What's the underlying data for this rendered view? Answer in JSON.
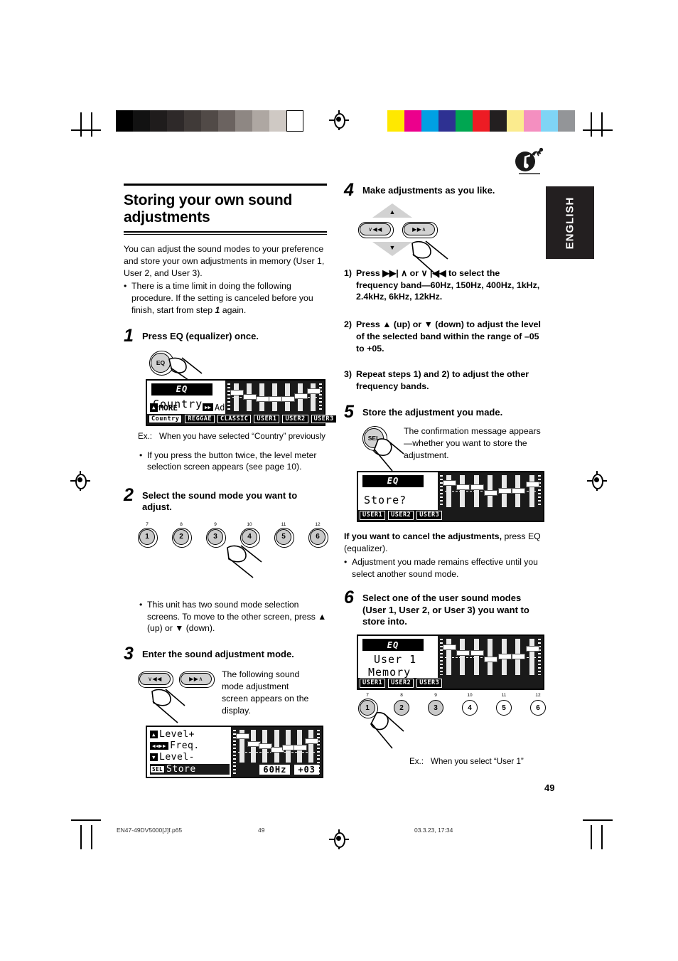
{
  "document": {
    "language_tab": "ENGLISH",
    "page_number": "49",
    "footer": {
      "filename": "EN47-49DV5000[J]f.p65",
      "page": "49",
      "timestamp": "03.3.23, 17:34"
    }
  },
  "heading": {
    "title_line1": "Storing your own sound",
    "title_line2": "adjustments"
  },
  "intro": {
    "paragraph": "You can adjust the sound modes to your preference and store your own adjustments in memory (User 1, User 2, and User 3).",
    "bullet_pre": "There is a time limit in doing the following procedure. If the setting is canceled before you finish, start from step ",
    "bullet_step": "1",
    "bullet_post": " again."
  },
  "steps": {
    "step1": {
      "number": "1",
      "heading": "Press EQ (equalizer) once.",
      "button_label": "EQ",
      "caption_label": "Ex.:",
      "caption_text": "When you have selected “Country” previously",
      "bullet": "If you press the button twice, the level meter selection screen appears (see page 10).",
      "lcd": {
        "logo": "EQ",
        "mode_name": "Country",
        "more_label": "MORE",
        "adj_label": "Adj",
        "tags": [
          "Country",
          "REGGAE",
          "CLASSIC",
          "USER1",
          "USER2",
          "USER3"
        ],
        "fader_levels": [
          3,
          1,
          0,
          0,
          0,
          1,
          4
        ]
      }
    },
    "step2": {
      "number": "2",
      "heading": "Select the sound mode you want to adjust.",
      "preset_numbers": [
        "1",
        "2",
        "3",
        "4",
        "5",
        "6"
      ],
      "preset_top_labels": [
        "7",
        "8",
        "9",
        "10",
        "11",
        "12"
      ],
      "bullet": "This unit has two sound mode selection screens. To move to the other screen, press ▲ (up) or ▼ (down)."
    },
    "step3": {
      "number": "3",
      "heading": "Enter the sound adjustment mode.",
      "note": "The following sound mode adjustment screen appears on the display.",
      "btn_left": "∨◀◀",
      "btn_right": "▶▶∧",
      "lcd": {
        "menu": [
          {
            "chip": "▲",
            "label": "Level+"
          },
          {
            "chip": "◀◀ ▶▶",
            "label": "Freq."
          },
          {
            "chip": "▼",
            "label": "Level-"
          },
          {
            "chip": "SEL",
            "label": "Store"
          }
        ],
        "freq_readout": "60Hz",
        "level_readout": "+03",
        "fader_levels": [
          5,
          2,
          1,
          0,
          1,
          1,
          3
        ]
      }
    },
    "step4": {
      "number": "4",
      "heading": "Make adjustments as you like.",
      "btn_left": "∨◀◀",
      "btn_right": "▶▶∧",
      "substeps": [
        {
          "n": "1)",
          "text": "Press ▶▶| ∧ or ∨ |◀◀ to select the frequency band—60Hz, 150Hz, 400Hz, 1kHz, 2.4kHz, 6kHz, 12kHz."
        },
        {
          "n": "2)",
          "text": "Press ▲ (up) or ▼ (down) to adjust the level of the selected band within the range of –05 to +05."
        },
        {
          "n": "3)",
          "text": "Repeat steps 1) and 2) to adjust the other frequency bands."
        }
      ]
    },
    "step5": {
      "number": "5",
      "heading": "Store the adjustment you made.",
      "button_label": "SEL",
      "note": "The confirmation message appears—whether you want to store the adjustment.",
      "lcd": {
        "logo": "EQ",
        "message": "Store?",
        "tags": [
          "USER1",
          "USER2",
          "USER3"
        ],
        "fader_levels": [
          4,
          2,
          2,
          0,
          1,
          1,
          3
        ]
      },
      "cancel_bold": "If you want to cancel the adjustments,",
      "cancel_rest": " press EQ (equalizer).",
      "cancel_bullet": "Adjustment you made remains effective until you select another sound mode."
    },
    "step6": {
      "number": "6",
      "heading": "Select one of the user sound modes (User 1, User 2, or User 3) you want to store into.",
      "lcd": {
        "logo": "EQ",
        "line1": "User 1",
        "line2": "Memory",
        "tags": [
          "USER1",
          "USER2",
          "USER3"
        ],
        "fader_levels": [
          4,
          2,
          2,
          0,
          1,
          1,
          3
        ]
      },
      "preset_numbers": [
        "1",
        "2",
        "3",
        "4",
        "5",
        "6"
      ],
      "preset_top_labels": [
        "7",
        "8",
        "9",
        "10",
        "11",
        "12"
      ],
      "caption_label": "Ex.:",
      "caption_text": "When you select “User 1”"
    }
  },
  "colors": {
    "gray_bars": [
      "#000000",
      "#121212",
      "#1f1c1c",
      "#2e2929",
      "#403a38",
      "#514a47",
      "#6b6360",
      "#8e8783",
      "#aea7a2",
      "#cfc9c4",
      "#ffffff"
    ],
    "color_bars": [
      "#ffe800",
      "#ec008c",
      "#00a0e3",
      "#2e3192",
      "#00a651",
      "#ed1c24",
      "#231f20",
      "#fbeb8e",
      "#f48fc0",
      "#7fd4f5",
      "#939598"
    ]
  }
}
